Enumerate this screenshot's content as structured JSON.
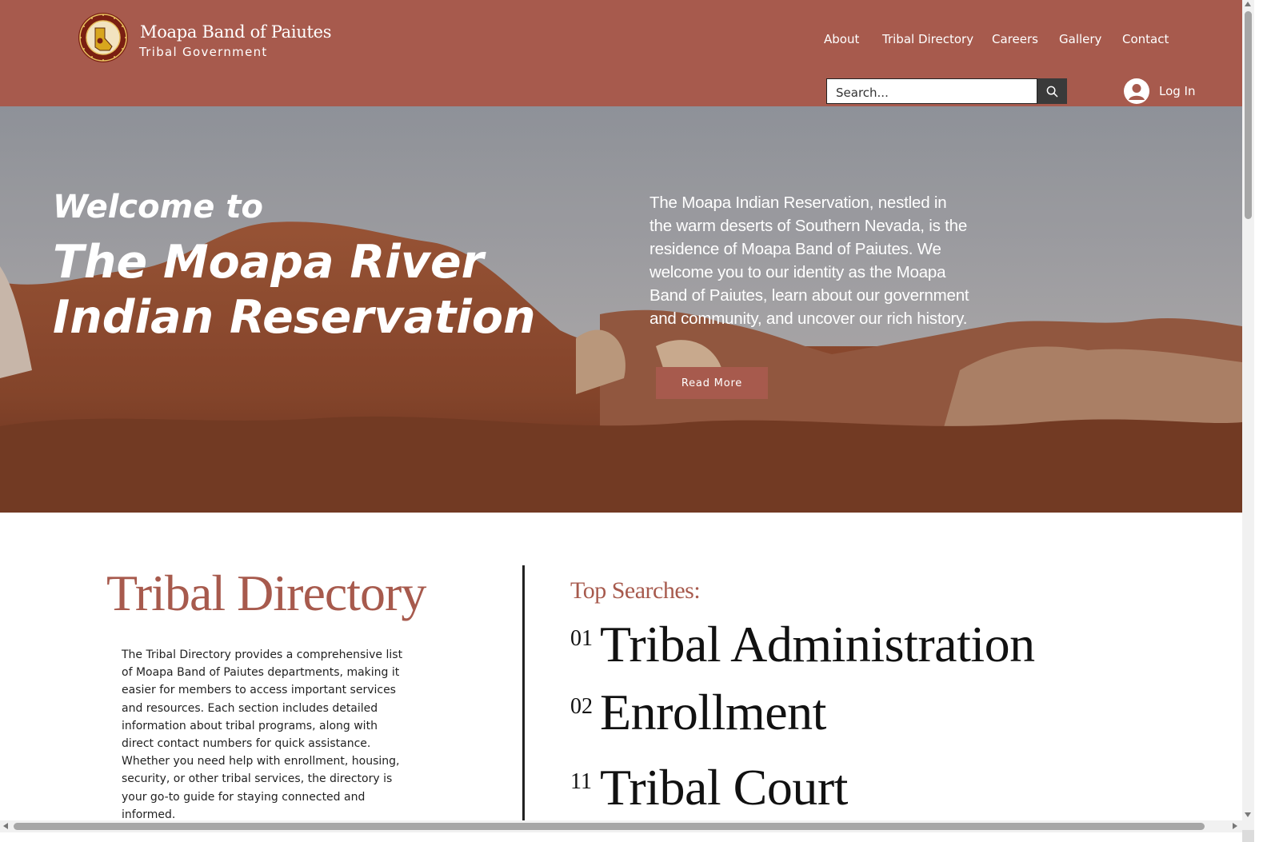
{
  "header": {
    "brand_name": "Moapa Band of Paiutes",
    "brand_sub": "Tribal Government",
    "nav": [
      "About",
      "Tribal Directory",
      "Careers",
      "Gallery",
      "Contact"
    ],
    "search": {
      "placeholder": "Search..."
    },
    "login_label": "Log In",
    "logo": {
      "icon": "tribal-seal-icon",
      "text": "THE GREAT SEAL OF MOAPA PAIUTE"
    }
  },
  "hero": {
    "welcome": "Welcome to",
    "title": "The Moapa River Indian Reservation",
    "description": "The Moapa Indian Reservation, nestled in the warm deserts of Southern Nevada, is the residence of Moapa Band of Paiutes. We welcome you to our identity as the Moapa Band of Paiutes, learn about our government and community, and uncover our rich history.",
    "button_label": "Read More"
  },
  "directory": {
    "title": "Tribal Directory",
    "description": "The Tribal Directory provides a comprehensive list of Moapa Band of Paiutes departments, making it easier for members to access important services and resources. Each section includes detailed information about tribal programs, along with direct contact numbers for quick assistance. Whether you need help with enrollment, housing, security, or other tribal services, the directory is your go-to guide for staying connected and informed.",
    "top_searches_label": "Top Searches:",
    "top_searches": [
      {
        "num": "01",
        "label": "Tribal Administration"
      },
      {
        "num": "02",
        "label": "Enrollment"
      },
      {
        "num": "11",
        "label": "Tribal Court"
      }
    ]
  },
  "colors": {
    "brand": "#a75a4d",
    "text_dark": "#111111"
  }
}
